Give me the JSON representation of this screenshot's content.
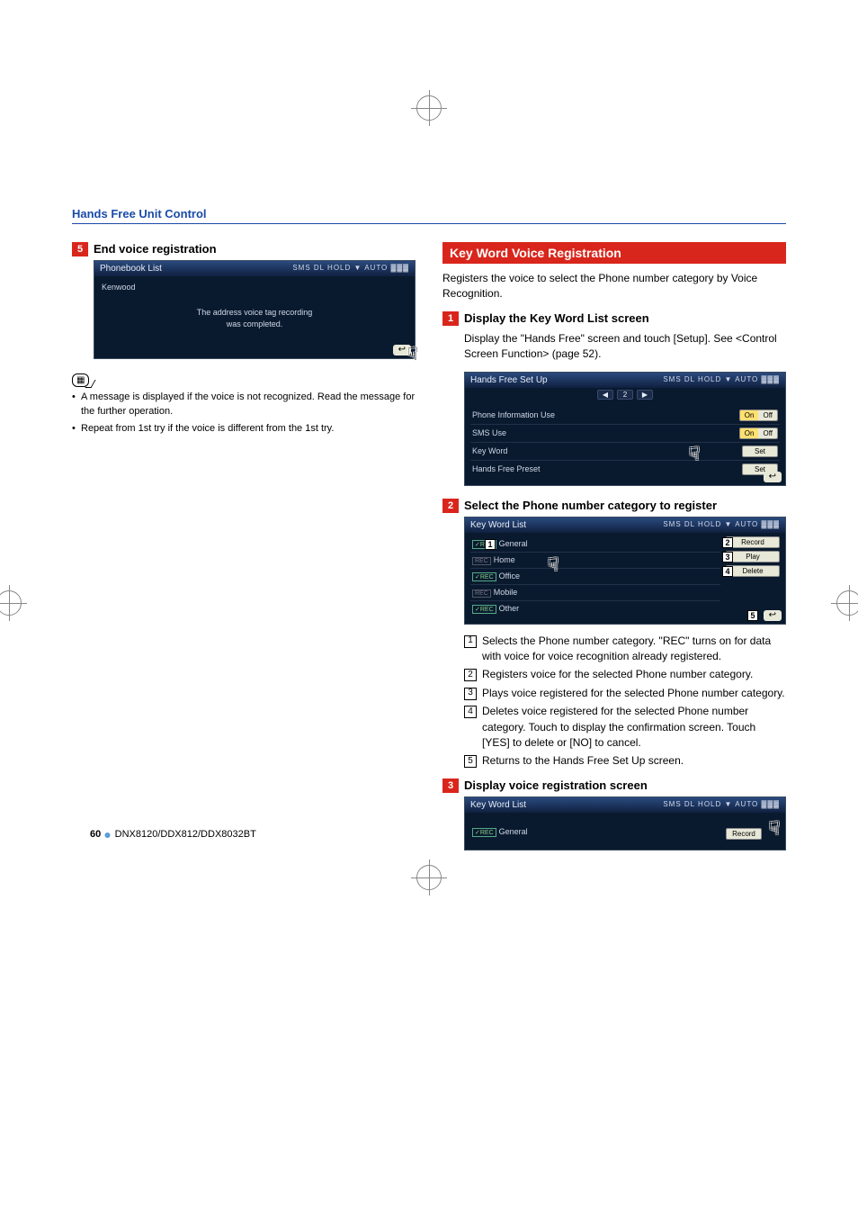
{
  "section_header": "Hands Free Unit Control",
  "left": {
    "step5_num": "5",
    "step5_title": "End voice registration",
    "ss1": {
      "title": "Phonebook List",
      "icons": "SMS  DL  HOLD  ▼  AUTO  ▓▓▓",
      "entry": "Kenwood",
      "msg1": "The address voice tag recording",
      "msg2": "was completed."
    },
    "note1": "A message is displayed if the voice is not recognized. Read the message for the further operation.",
    "note2": "Repeat from 1st try if the voice is different from the 1st try."
  },
  "right": {
    "title": "Key Word Voice Registration",
    "intro": "Registers the voice to select the Phone number category by Voice Recognition.",
    "step1_num": "1",
    "step1_title": "Display the Key Word List screen",
    "step1_body": "Display the \"Hands Free\" screen and touch [Setup]. See <Control Screen Function> (page 52).",
    "ss2": {
      "title": "Hands Free Set Up",
      "icons": "SMS  DL  HOLD  ▼  AUTO  ▓▓▓",
      "page": "2",
      "row1": "Phone Information Use",
      "row2": "SMS Use",
      "row3": "Key Word",
      "row4": "Hands Free Preset",
      "on": "On",
      "off": "Off",
      "set": "Set"
    },
    "step2_num": "2",
    "step2_title": "Select the Phone number category to register",
    "ss3": {
      "title": "Key Word List",
      "icons": "SMS  DL  HOLD  ▼  AUTO  ▓▓▓",
      "items": [
        "General",
        "Home",
        "Office",
        "Mobile",
        "Other"
      ],
      "record": "Record",
      "play": "Play",
      "delete": "Delete"
    },
    "desc": {
      "d1": "Selects the Phone number category. \"REC\" turns on for data with voice for voice recognition already registered.",
      "d2": "Registers voice for the selected Phone number category.",
      "d3": "Plays voice registered for the selected Phone number category.",
      "d4": "Deletes voice registered for the selected Phone number category. Touch to display the confirmation screen. Touch [YES] to delete or [NO] to cancel.",
      "d5": "Returns to the Hands Free Set Up screen."
    },
    "step3_num": "3",
    "step3_title": "Display voice registration screen",
    "ss4": {
      "title": "Key Word List",
      "icons": "SMS  DL  HOLD  ▼  AUTO  ▓▓▓",
      "item": "General",
      "record": "Record"
    }
  },
  "footer": {
    "page_num": "60",
    "models": "DNX8120/DDX812/DDX8032BT"
  }
}
